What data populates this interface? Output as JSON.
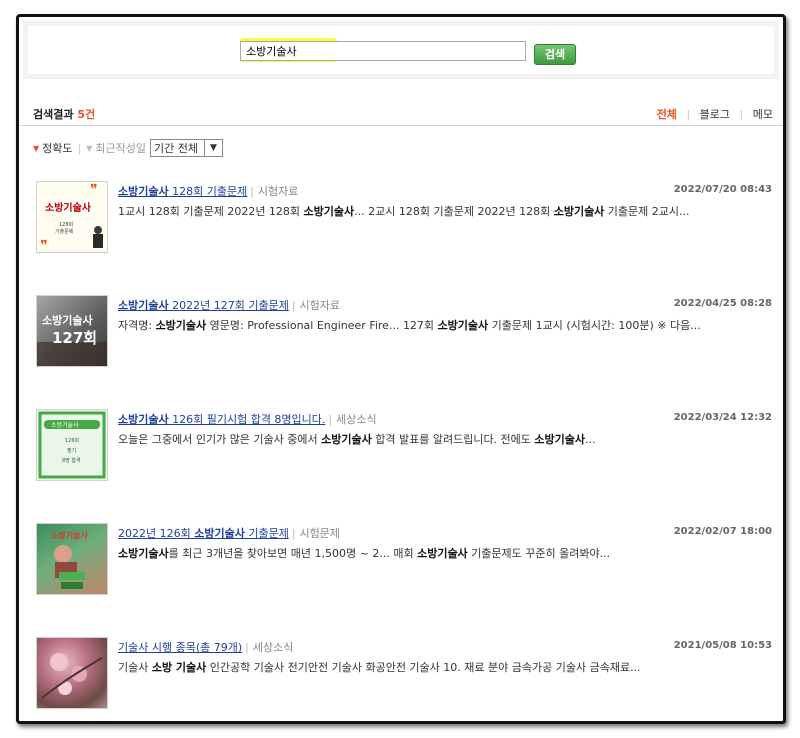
{
  "search": {
    "value": "소방기술사",
    "button": "검색"
  },
  "results": {
    "label": "검색결과",
    "count": "5건"
  },
  "filters": {
    "all": "전체",
    "blog": "블로그",
    "memo": "메모"
  },
  "sort": {
    "accuracy": "정확도",
    "recent": "최근작성일",
    "period": "기간 전체"
  },
  "posts": [
    {
      "title_parts": [
        "소방기술사",
        " 128회 기출문제"
      ],
      "category": "시험자료",
      "date": "2022/07/20 08:43",
      "summary": "1교시 128회 기출문제 2022년 128회 <b>소방기술사</b>... 2교시 128회 기출문제 2022년 128회 <b>소방기술사</b> 기출문제 2교시...",
      "thumb_text": "소방기술사",
      "thumb_sub": "128회 기출문제"
    },
    {
      "title_parts": [
        "소방기술사",
        " 2022년 127회 기출문제"
      ],
      "category": "시험자료",
      "date": "2022/04/25 08:28",
      "summary": "자격명: <b>소방기술사</b> 영문명: Professional Engineer Fire... 127회 <b>소방기술사</b> 기출문제 1교시 (시험시간: 100분) ※ 다음...",
      "thumb_text": "소방기술사",
      "thumb_sub": "127회"
    },
    {
      "title_parts": [
        "소방기술사",
        " 126회 필기시험 합격 8명입니다."
      ],
      "category": "세상소식",
      "date": "2022/03/24 12:32",
      "summary": "오늘은 그중에서 인기가 많은 기술사 중에서 <b>소방기술사</b> 합격 발표를 알려드립니다. 전에도 <b>소방기술사</b>...",
      "thumb_text": "소방기술사",
      "thumb_sub": "126회 필기 8명 합격"
    },
    {
      "title_parts": [
        "2022년 126회 ",
        "소방기술사",
        " 기출문제"
      ],
      "category": "시험문제",
      "date": "2022/02/07 18:00",
      "summary": "<b>소방기술사</b>를 최근 3개년을 찾아보면 매년 1,500명 ~ 2... 매회 <b>소방기술사</b> 기출문제도 꾸준히 올려봐야...",
      "thumb_text": "소방기술사",
      "thumb_sub": "126회"
    },
    {
      "title_parts": [
        "기술사 시행 종목(총 79개)"
      ],
      "category": "세상소식",
      "date": "2021/05/08 10:53",
      "summary": "기술사 <b>소방 기술사</b> 인간공학 기술사 전기안전 기술사 화공안전 기술사 10. 재료 분야 금속가공 기술사 금속재료...",
      "thumb_text": "",
      "thumb_sub": ""
    }
  ],
  "colors": {
    "accent": "#e8541c",
    "link": "#1e3fa0",
    "button": "#3e9a3e",
    "highlight": "#fbf91a"
  }
}
